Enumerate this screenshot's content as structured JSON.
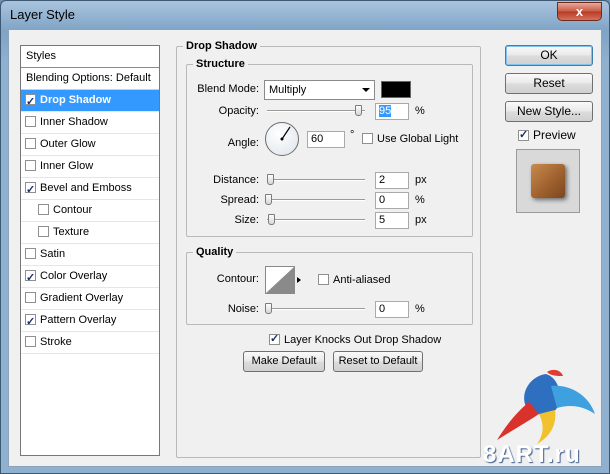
{
  "window": {
    "title": "Layer Style",
    "close_glyph": "x"
  },
  "styles_panel": {
    "header": "Styles",
    "blending_options": "Blending Options: Default",
    "items": [
      {
        "label": "Drop Shadow",
        "checked": true,
        "selected": true,
        "indent": false
      },
      {
        "label": "Inner Shadow",
        "checked": false,
        "selected": false,
        "indent": false
      },
      {
        "label": "Outer Glow",
        "checked": false,
        "selected": false,
        "indent": false
      },
      {
        "label": "Inner Glow",
        "checked": false,
        "selected": false,
        "indent": false
      },
      {
        "label": "Bevel and Emboss",
        "checked": true,
        "selected": false,
        "indent": false
      },
      {
        "label": "Contour",
        "checked": false,
        "selected": false,
        "indent": true
      },
      {
        "label": "Texture",
        "checked": false,
        "selected": false,
        "indent": true
      },
      {
        "label": "Satin",
        "checked": false,
        "selected": false,
        "indent": false
      },
      {
        "label": "Color Overlay",
        "checked": true,
        "selected": false,
        "indent": false
      },
      {
        "label": "Gradient Overlay",
        "checked": false,
        "selected": false,
        "indent": false
      },
      {
        "label": "Pattern Overlay",
        "checked": true,
        "selected": false,
        "indent": false
      },
      {
        "label": "Stroke",
        "checked": false,
        "selected": false,
        "indent": false
      }
    ]
  },
  "drop_shadow": {
    "title": "Drop Shadow",
    "structure": {
      "title": "Structure",
      "blend_mode_label": "Blend Mode:",
      "blend_mode_value": "Multiply",
      "shadow_color": "#000000",
      "opacity_label": "Opacity:",
      "opacity_value": "95",
      "opacity_unit": "%",
      "angle_label": "Angle:",
      "angle_value": "60",
      "angle_unit": "°",
      "use_global_light_label": "Use Global Light",
      "use_global_light_checked": false,
      "distance_label": "Distance:",
      "distance_value": "2",
      "distance_unit": "px",
      "spread_label": "Spread:",
      "spread_value": "0",
      "spread_unit": "%",
      "size_label": "Size:",
      "size_value": "5",
      "size_unit": "px"
    },
    "quality": {
      "title": "Quality",
      "contour_label": "Contour:",
      "anti_aliased_label": "Anti-aliased",
      "anti_aliased_checked": false,
      "noise_label": "Noise:",
      "noise_value": "0",
      "noise_unit": "%"
    },
    "knocks_out_label": "Layer Knocks Out Drop Shadow",
    "knocks_out_checked": true,
    "make_default_label": "Make Default",
    "reset_default_label": "Reset to Default"
  },
  "buttons": {
    "ok": "OK",
    "reset": "Reset",
    "new_style": "New Style...",
    "preview_label": "Preview",
    "preview_checked": true
  },
  "watermark": "8ART.ru"
}
